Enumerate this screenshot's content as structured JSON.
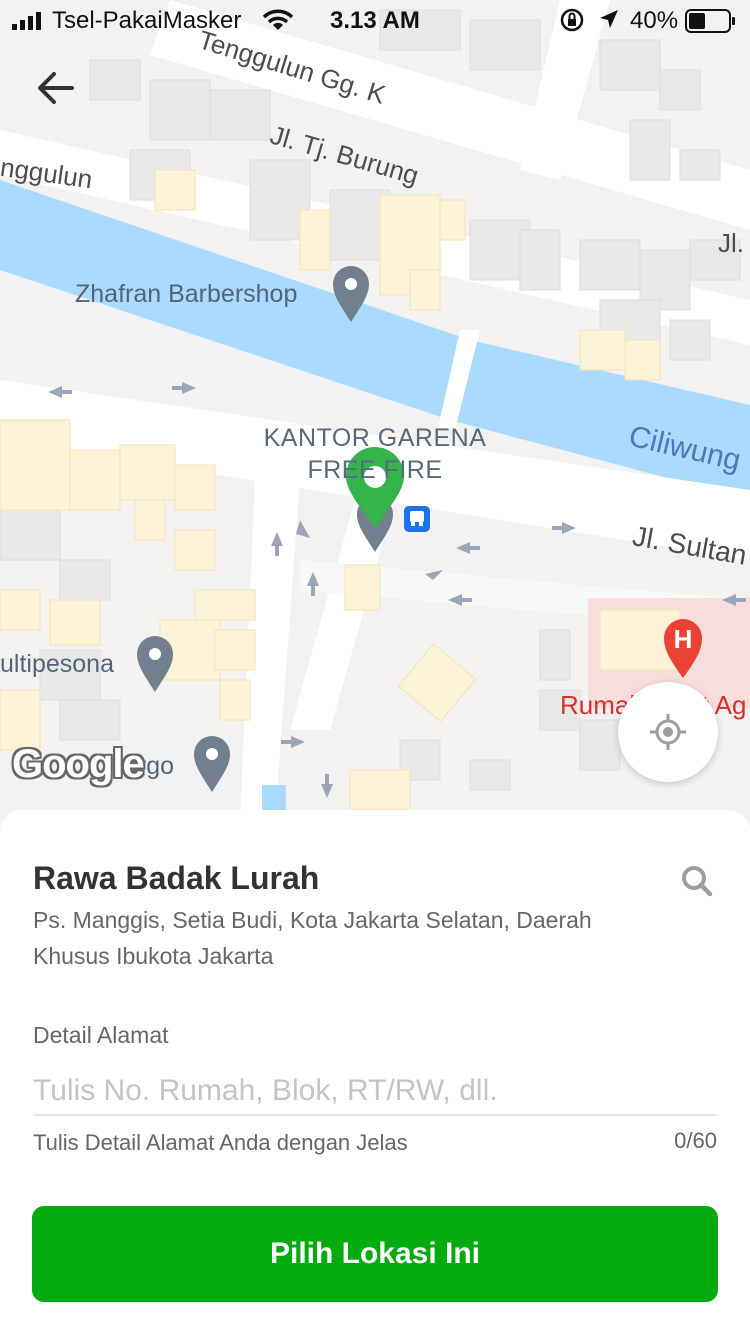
{
  "status_bar": {
    "carrier": "Tsel-PakaiMasker",
    "time": "3.13 AM",
    "battery": "40%"
  },
  "map": {
    "labels": {
      "street_top": "Tenggulun Gg. K",
      "street_left": "nggulun",
      "street_burung": "Jl. Tj. Burung",
      "street_jl_top_right": "Jl.",
      "barbershop": "Zhafran Barbershop",
      "river": "Ciliwung",
      "kantor_line1": "KANTOR GARENA",
      "kantor_line2": "FREE FIRE",
      "street_sultan": "Jl. Sultan",
      "multipesona": "ultipesona",
      "hospital": "Rumah Sakit Ag",
      "cargo": "argo",
      "google": "Google"
    }
  },
  "icons": {
    "back": "back-arrow-icon",
    "locate": "my-location-icon",
    "search": "search-icon",
    "selected_pin": "green-location-pin-icon",
    "poi_pin": "gray-location-pin-icon",
    "bus": "bus-stop-icon",
    "hospital": "hospital-icon"
  },
  "colors": {
    "accent": "#03ac0e",
    "water": "#aadaff",
    "hospital": "#ea4335"
  },
  "location": {
    "title": "Rawa Badak Lurah",
    "address": "Ps. Manggis, Setia Budi, Kota Jakarta Selatan, Daerah Khusus Ibukota Jakarta"
  },
  "detail": {
    "label": "Detail Alamat",
    "placeholder": "Tulis No. Rumah, Blok, RT/RW, dll.",
    "value": "",
    "hint": "Tulis Detail Alamat Anda dengan Jelas",
    "counter": "0/60"
  },
  "confirm_button": {
    "label": "Pilih Lokasi Ini"
  }
}
